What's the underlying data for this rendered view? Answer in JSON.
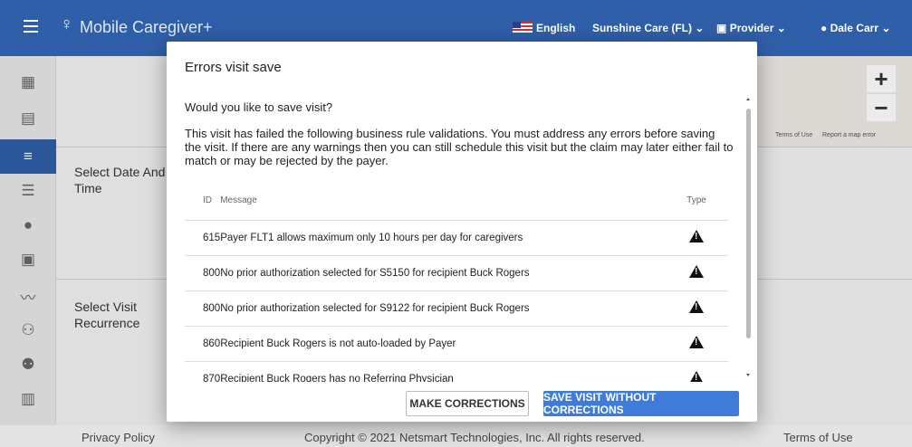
{
  "topbar": {
    "brand": "Mobile Caregiver+",
    "language": "English",
    "agency": "Sunshine Care (FL)",
    "role": "Provider",
    "user": "Dale Carr"
  },
  "sidebar": {
    "items": [
      {
        "icon": "dashboard-icon"
      },
      {
        "icon": "calendar-icon"
      },
      {
        "icon": "filter-icon",
        "active": true
      },
      {
        "icon": "list-icon"
      },
      {
        "icon": "alert-icon"
      },
      {
        "icon": "schedule-icon"
      },
      {
        "icon": "chart-icon"
      },
      {
        "icon": "group-icon"
      },
      {
        "icon": "people-icon"
      },
      {
        "icon": "clipboard-icon"
      }
    ]
  },
  "content": {
    "section_date": "Select Date And Time",
    "section_recurrence": "Select Visit Recurrence"
  },
  "map": {
    "terms": "Terms of Use",
    "report": "Report a map error",
    "zoom_in": "+",
    "zoom_out": "−"
  },
  "dialog": {
    "title": "Errors visit save",
    "question": "Would you like to save visit?",
    "description": "This visit has failed the following business rule validations. You must address any errors before saving the visit. If there are any warnings then you can still schedule this visit but the claim may later either fail to match or may be rejected by the payer.",
    "columns": {
      "id": "ID",
      "message": "Message",
      "type": "Type"
    },
    "rows": [
      {
        "id": "615",
        "message": "Payer FLT1 allows maximum only 10 hours per day for caregivers",
        "type": "warning-icon"
      },
      {
        "id": "800",
        "message": "No prior authorization selected for S5150 for recipient Buck Rogers",
        "type": "warning-icon"
      },
      {
        "id": "800",
        "message": "No prior authorization selected for S9122 for recipient Buck Rogers",
        "type": "warning-icon"
      },
      {
        "id": "860",
        "message": "Recipient Buck Rogers is not auto-loaded by Payer",
        "type": "warning-icon"
      },
      {
        "id": "870",
        "message": "Recipient Buck Rogers has no Referring Physician",
        "type": "warning-icon"
      }
    ],
    "btn_corrections": "MAKE CORRECTIONS",
    "btn_save": "SAVE VISIT WITHOUT CORRECTIONS"
  },
  "footer": {
    "privacy": "Privacy Policy",
    "copyright": "Copyright © 2021 Netsmart Technologies, Inc. All rights reserved.",
    "terms": "Terms of Use"
  },
  "colors": {
    "primary": "#2f5fa8",
    "button": "#3f7bd9"
  }
}
